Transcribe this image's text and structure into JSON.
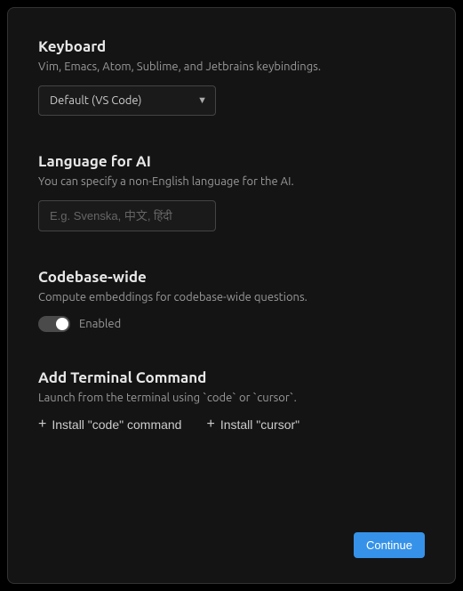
{
  "keyboard": {
    "title": "Keyboard",
    "desc": "Vim, Emacs, Atom, Sublime, and Jetbrains keybindings.",
    "selected": "Default (VS Code)"
  },
  "language": {
    "title": "Language for AI",
    "desc": "You can specify a non-English language for the AI.",
    "placeholder": "E.g. Svenska, 中文, हिंदी",
    "value": ""
  },
  "codebase": {
    "title": "Codebase-wide",
    "desc": "Compute embeddings for codebase-wide questions.",
    "toggle_label": "Enabled",
    "enabled": true
  },
  "terminal": {
    "title": "Add Terminal Command",
    "desc": "Launch from the terminal using `code` or `cursor`.",
    "install_code": "Install \"code\" command",
    "install_cursor": "Install \"cursor\""
  },
  "footer": {
    "continue": "Continue"
  }
}
